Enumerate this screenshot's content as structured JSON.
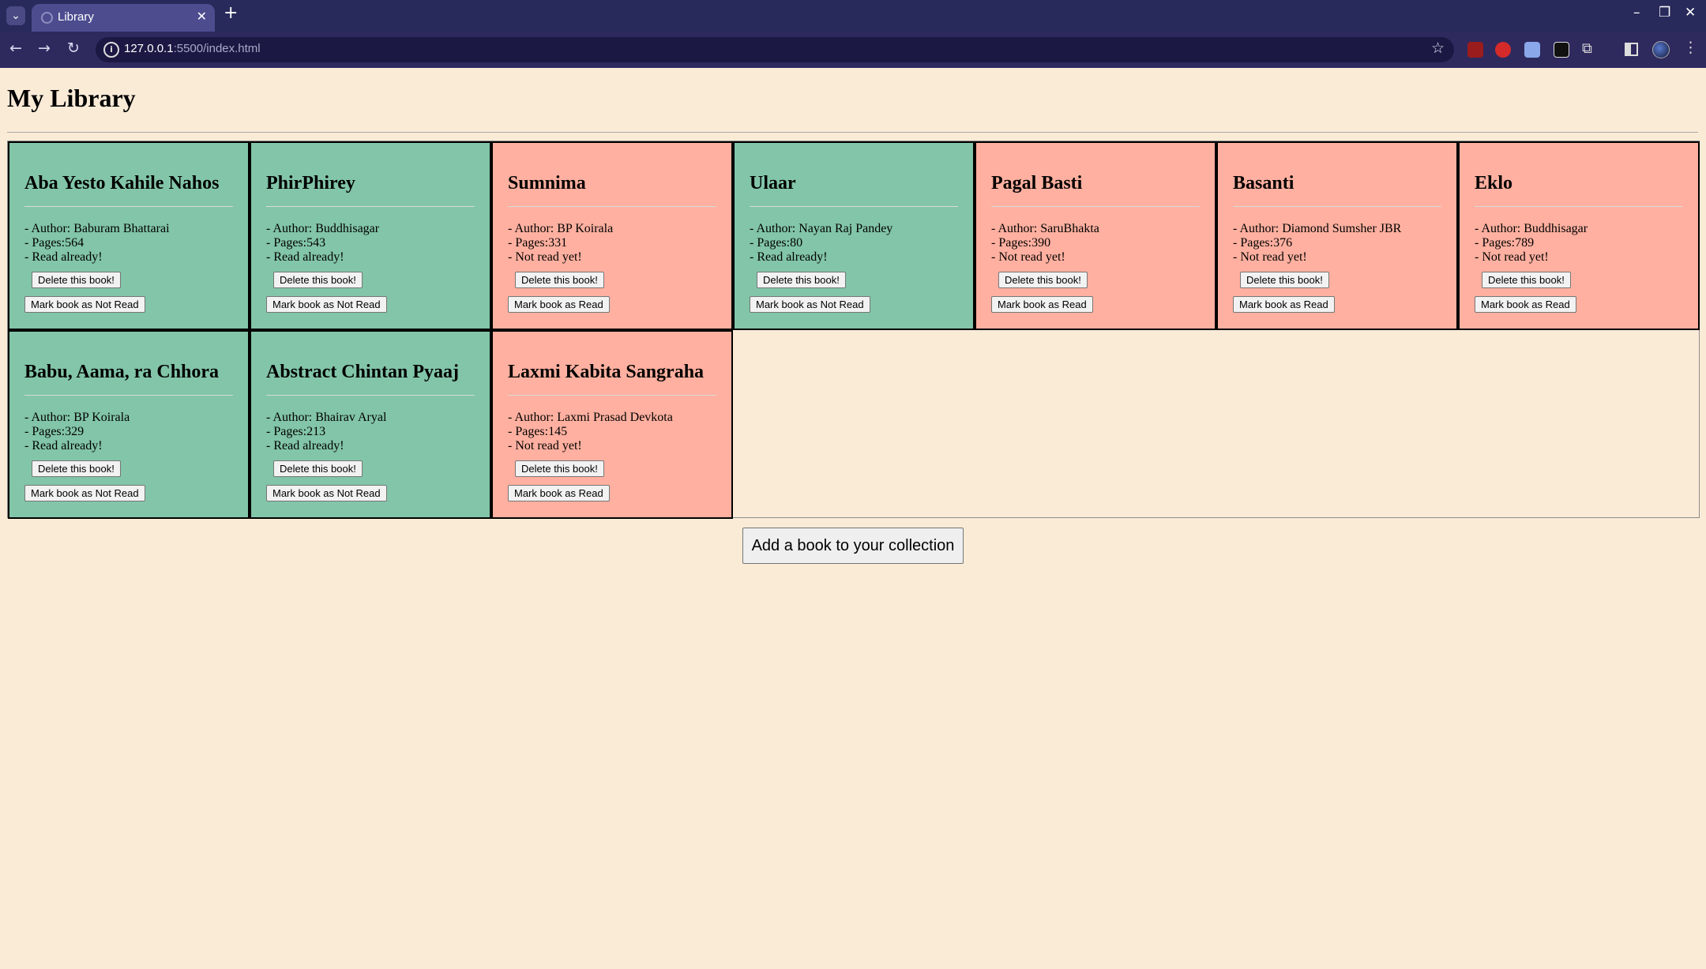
{
  "browser": {
    "tab_title": "Library",
    "url_host": "127.0.0.1",
    "url_rest": ":5500/index.html"
  },
  "page": {
    "title": "My Library",
    "add_button": "Add a book to your collection"
  },
  "colors": {
    "read": "#82c5a8",
    "unread": "#ffb0a0",
    "background": "#faebd7"
  },
  "books": [
    {
      "title": "Aba Yesto Kahile Nahos",
      "author": "- Author: Baburam Bhattarai",
      "pages": "- Pages:564",
      "status": "- Read already!",
      "read": true,
      "delete_label": "Delete this book!",
      "toggle_label": "Mark book as Not Read"
    },
    {
      "title": "PhirPhirey",
      "author": "- Author: Buddhisagar",
      "pages": "- Pages:543",
      "status": "- Read already!",
      "read": true,
      "delete_label": "Delete this book!",
      "toggle_label": "Mark book as Not Read"
    },
    {
      "title": "Sumnima",
      "author": "- Author: BP Koirala",
      "pages": "- Pages:331",
      "status": "- Not read yet!",
      "read": false,
      "delete_label": "Delete this book!",
      "toggle_label": "Mark book as Read"
    },
    {
      "title": "Ulaar",
      "author": "- Author: Nayan Raj Pandey",
      "pages": "- Pages:80",
      "status": "- Read already!",
      "read": true,
      "delete_label": "Delete this book!",
      "toggle_label": "Mark book as Not Read"
    },
    {
      "title": "Pagal Basti",
      "author": "- Author: SaruBhakta",
      "pages": "- Pages:390",
      "status": "- Not read yet!",
      "read": false,
      "delete_label": "Delete this book!",
      "toggle_label": "Mark book as Read"
    },
    {
      "title": "Basanti",
      "author": "- Author: Diamond Sumsher JBR",
      "pages": "- Pages:376",
      "status": "- Not read yet!",
      "read": false,
      "delete_label": "Delete this book!",
      "toggle_label": "Mark book as Read"
    },
    {
      "title": "Eklo",
      "author": "- Author: Buddhisagar",
      "pages": "- Pages:789",
      "status": "- Not read yet!",
      "read": false,
      "delete_label": "Delete this book!",
      "toggle_label": "Mark book as Read"
    },
    {
      "title": "Babu, Aama, ra Chhora",
      "author": "- Author: BP Koirala",
      "pages": "- Pages:329",
      "status": "- Read already!",
      "read": true,
      "delete_label": "Delete this book!",
      "toggle_label": "Mark book as Not Read"
    },
    {
      "title": "Abstract Chintan Pyaaj",
      "author": "- Author: Bhairav Aryal",
      "pages": "- Pages:213",
      "status": "- Read already!",
      "read": true,
      "delete_label": "Delete this book!",
      "toggle_label": "Mark book as Not Read"
    },
    {
      "title": "Laxmi Kabita Sangraha",
      "author": "- Author: Laxmi Prasad Devkota",
      "pages": "- Pages:145",
      "status": "- Not read yet!",
      "read": false,
      "delete_label": "Delete this book!",
      "toggle_label": "Mark book as Read"
    }
  ]
}
